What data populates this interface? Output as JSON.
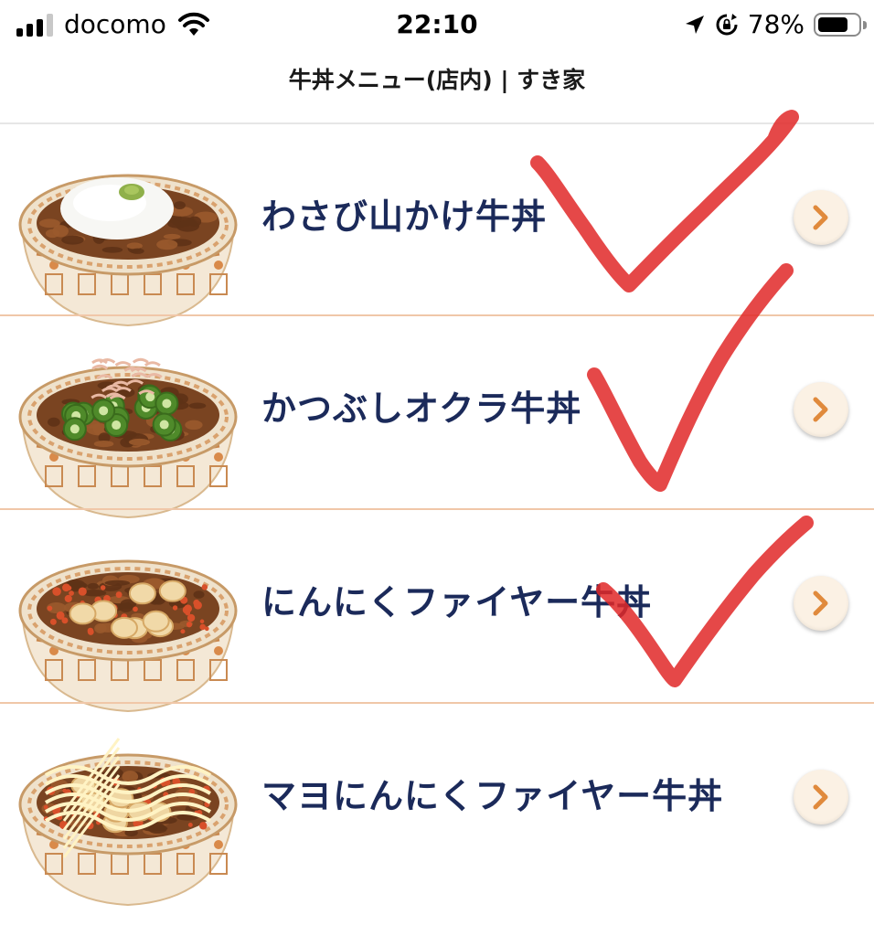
{
  "status_bar": {
    "carrier": "docomo",
    "time": "22:10",
    "battery_percent": "78%",
    "battery_level": 0.78
  },
  "page": {
    "title": "牛丼メニュー(店内) | すき家"
  },
  "menu_items": [
    {
      "name": "わさび山かけ牛丼",
      "topping": "wasabi-yamakake"
    },
    {
      "name": "かつぶしオクラ牛丼",
      "topping": "katsubushi-okra"
    },
    {
      "name": "にんにくファイヤー牛丼",
      "topping": "garlic-fire"
    },
    {
      "name": "マヨにんにくファイヤー牛丼",
      "topping": "mayo-garlic-fire"
    }
  ],
  "annotations": {
    "checkmark_color": "#e02828",
    "checked_items": 3
  },
  "colors": {
    "menu_text": "#1b2a5a",
    "row_divider": "#f0c7a8",
    "chevron": "#e08a3c",
    "chevron_bg": "#fbf1e4"
  },
  "icons": [
    "signal-icon",
    "wifi-icon",
    "location-icon",
    "rotation-lock-icon",
    "battery-icon",
    "chevron-right-icon"
  ]
}
